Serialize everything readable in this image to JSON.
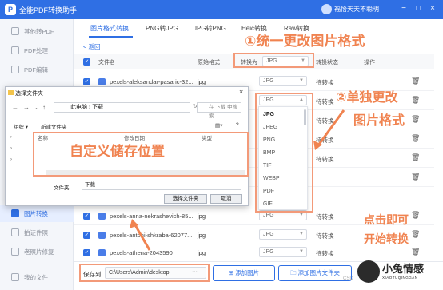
{
  "app": {
    "title": "全能PDF转换助手",
    "logo_letter": "P",
    "user": "福怡天天不聪明"
  },
  "window_controls": [
    "−",
    "□",
    "×"
  ],
  "sidebar": {
    "items": [
      {
        "label": "其他转PDF",
        "active": false
      },
      {
        "label": "PDF处理",
        "active": false
      },
      {
        "label": "PDF编辑",
        "active": false
      },
      {
        "label": "图片转换",
        "active": true
      },
      {
        "label": "拍证件照",
        "active": false
      },
      {
        "label": "老照片修复",
        "active": false
      },
      {
        "label": "我的文件",
        "active": false
      }
    ]
  },
  "tabs": [
    {
      "label": "图片格式转换",
      "active": true
    },
    {
      "label": "PNG转JPG",
      "active": false
    },
    {
      "label": "JPG转PNG",
      "active": false
    },
    {
      "label": "Heic转换",
      "active": false
    },
    {
      "label": "Raw转换",
      "active": false
    }
  ],
  "back_label": "< 返回",
  "table": {
    "headers": {
      "filename": "文件名",
      "original_format": "原始格式",
      "convert_to": "转换为",
      "status": "转换状态",
      "action": "操作"
    },
    "bulk_target": "JPG",
    "rows": [
      {
        "name": "pexels-aleksandar-pasaric-32...",
        "format": "jpg",
        "target": "JPG",
        "status": "待转换"
      },
      {
        "name": "",
        "format": "",
        "target": "JPG",
        "status": "待转换"
      },
      {
        "name": "",
        "format": "",
        "target": "",
        "status": "待转换"
      },
      {
        "name": "",
        "format": "",
        "target": "",
        "status": "待转换"
      },
      {
        "name": "",
        "format": "",
        "target": "",
        "status": "待转换"
      },
      {
        "name": "pexels-anna-nekrashevich-85...",
        "format": "jpg",
        "target": "JPG",
        "status": "待转换"
      },
      {
        "name": "pexels-antoni-shkraba-62077...",
        "format": "jpg",
        "target": "JPG",
        "status": "待转换"
      },
      {
        "name": "pexels-athena-2043590",
        "format": "jpg",
        "target": "JPG",
        "status": "待转换"
      }
    ]
  },
  "format_dropdown": {
    "options": [
      "JPG",
      "JPEG",
      "PNG",
      "BMP",
      "TIF",
      "WEBP",
      "PDF",
      "GIF"
    ]
  },
  "dialog": {
    "title": "选择文件夹",
    "path": [
      "此电脑",
      "下载"
    ],
    "search_placeholder": "在 下载 中搜索",
    "organize": "组织 ▾",
    "new_folder": "新建文件夹",
    "columns": [
      "名称",
      "修改日期",
      "类型"
    ],
    "folder_label": "文件夹:",
    "folder_value": "下载",
    "select_button": "选择文件夹",
    "cancel_button": "取消"
  },
  "bottom": {
    "save_label": "保存到:",
    "save_path": "C:\\Users\\Admin\\desktop",
    "browse": "···",
    "add_image": "添加图片",
    "add_folder": "添加图片文件夹"
  },
  "annotations": {
    "unify_format": "①统一更改图片格式",
    "single_line1": "②单独更改",
    "single_line2": "图片格式",
    "custom_location": "自定义储存位置",
    "click_line1": "点击即可",
    "click_line2": "开始转换"
  },
  "watermark": {
    "title": "小兔情感",
    "subtitle": "XIAOTUQINGGAN",
    "corner": "CSD"
  },
  "colors": {
    "accent": "#2f6fe4",
    "annotation": "#f08350"
  }
}
